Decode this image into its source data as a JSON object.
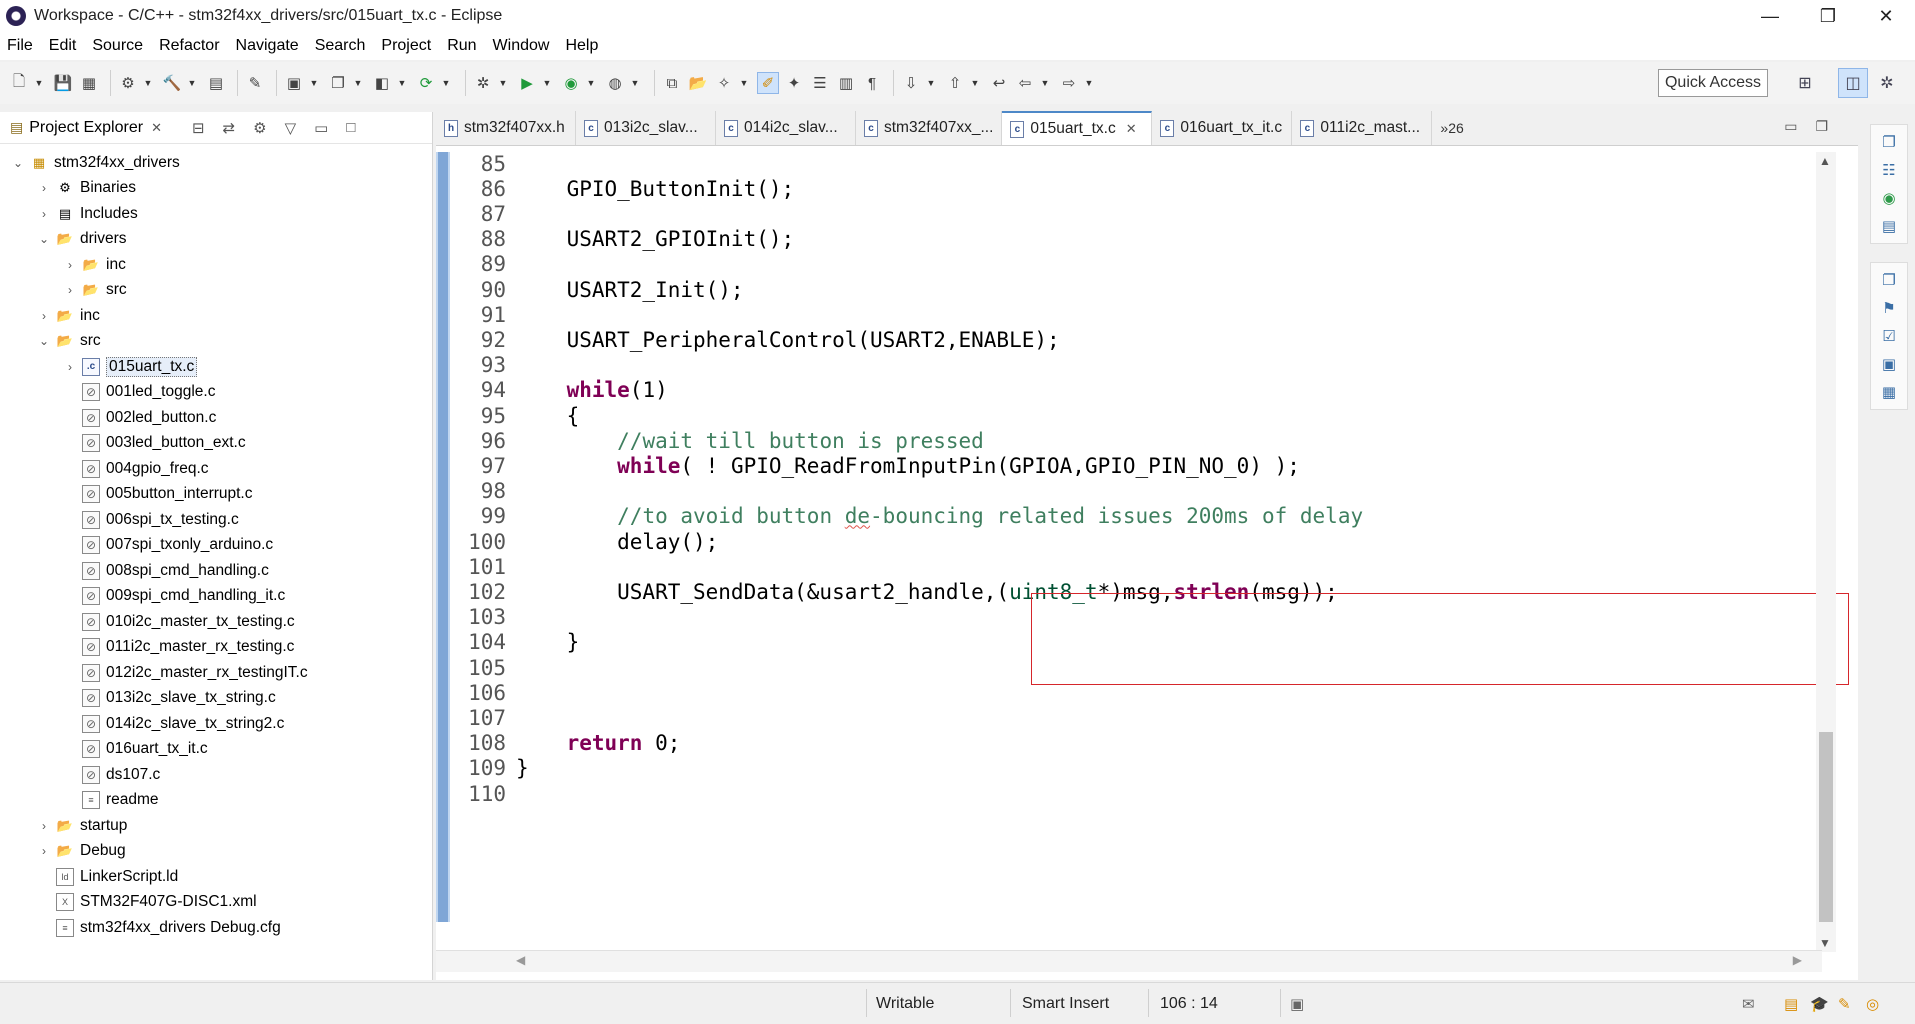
{
  "window": {
    "title": "Workspace - C/C++ - stm32f4xx_drivers/src/015uart_tx.c - Eclipse",
    "minimize": "—",
    "maximize": "❐",
    "close": "✕"
  },
  "menu": [
    "File",
    "Edit",
    "Source",
    "Refactor",
    "Navigate",
    "Search",
    "Project",
    "Run",
    "Window",
    "Help"
  ],
  "toolbar": {
    "quick_access": "Quick Access"
  },
  "explorer": {
    "title": "Project Explorer",
    "close": "✕",
    "tree": [
      {
        "label": "stm32f4xx_drivers",
        "depth": 0,
        "arrow": "v",
        "icon": "project"
      },
      {
        "label": "Binaries",
        "depth": 1,
        "arrow": ">",
        "icon": "binaries"
      },
      {
        "label": "Includes",
        "depth": 1,
        "arrow": ">",
        "icon": "includes"
      },
      {
        "label": "drivers",
        "depth": 1,
        "arrow": "v",
        "icon": "folder"
      },
      {
        "label": "inc",
        "depth": 2,
        "arrow": ">",
        "icon": "folder"
      },
      {
        "label": "src",
        "depth": 2,
        "arrow": ">",
        "icon": "folder"
      },
      {
        "label": "inc",
        "depth": 1,
        "arrow": ">",
        "icon": "folder"
      },
      {
        "label": "src",
        "depth": 1,
        "arrow": "v",
        "icon": "folder"
      },
      {
        "label": "015uart_tx.c",
        "depth": 2,
        "arrow": ">",
        "icon": "c-file",
        "selected": true
      },
      {
        "label": "001led_toggle.c",
        "depth": 2,
        "arrow": "",
        "icon": "excluded-file"
      },
      {
        "label": "002led_button.c",
        "depth": 2,
        "arrow": "",
        "icon": "excluded-file"
      },
      {
        "label": "003led_button_ext.c",
        "depth": 2,
        "arrow": "",
        "icon": "excluded-file"
      },
      {
        "label": "004gpio_freq.c",
        "depth": 2,
        "arrow": "",
        "icon": "excluded-file"
      },
      {
        "label": "005button_interrupt.c",
        "depth": 2,
        "arrow": "",
        "icon": "excluded-file"
      },
      {
        "label": "006spi_tx_testing.c",
        "depth": 2,
        "arrow": "",
        "icon": "excluded-file"
      },
      {
        "label": "007spi_txonly_arduino.c",
        "depth": 2,
        "arrow": "",
        "icon": "excluded-file"
      },
      {
        "label": "008spi_cmd_handling.c",
        "depth": 2,
        "arrow": "",
        "icon": "excluded-file"
      },
      {
        "label": "009spi_cmd_handling_it.c",
        "depth": 2,
        "arrow": "",
        "icon": "excluded-file"
      },
      {
        "label": "010i2c_master_tx_testing.c",
        "depth": 2,
        "arrow": "",
        "icon": "excluded-file"
      },
      {
        "label": "011i2c_master_rx_testing.c",
        "depth": 2,
        "arrow": "",
        "icon": "excluded-file"
      },
      {
        "label": "012i2c_master_rx_testingIT.c",
        "depth": 2,
        "arrow": "",
        "icon": "excluded-file"
      },
      {
        "label": "013i2c_slave_tx_string.c",
        "depth": 2,
        "arrow": "",
        "icon": "excluded-file"
      },
      {
        "label": "014i2c_slave_tx_string2.c",
        "depth": 2,
        "arrow": "",
        "icon": "excluded-file"
      },
      {
        "label": "016uart_tx_it.c",
        "depth": 2,
        "arrow": "",
        "icon": "excluded-file"
      },
      {
        "label": "ds107.c",
        "depth": 2,
        "arrow": "",
        "icon": "excluded-file"
      },
      {
        "label": "readme",
        "depth": 2,
        "arrow": "",
        "icon": "text-file"
      },
      {
        "label": "startup",
        "depth": 1,
        "arrow": ">",
        "icon": "folder"
      },
      {
        "label": "Debug",
        "depth": 1,
        "arrow": ">",
        "icon": "folder"
      },
      {
        "label": "LinkerScript.ld",
        "depth": 1,
        "arrow": "",
        "icon": "ld-file"
      },
      {
        "label": "STM32F407G-DISC1.xml",
        "depth": 1,
        "arrow": "",
        "icon": "xml-file"
      },
      {
        "label": "stm32f4xx_drivers Debug.cfg",
        "depth": 1,
        "arrow": "",
        "icon": "cfg-file"
      }
    ]
  },
  "editor": {
    "tabs": [
      {
        "label": "stm32f407xx.h",
        "icon": "h"
      },
      {
        "label": "013i2c_slav...",
        "icon": "c"
      },
      {
        "label": "014i2c_slav...",
        "icon": "c"
      },
      {
        "label": "stm32f407xx_...",
        "icon": "c"
      },
      {
        "label": "015uart_tx.c",
        "icon": "c",
        "active": true
      },
      {
        "label": "016uart_tx_it.c",
        "icon": "c"
      },
      {
        "label": "011i2c_mast...",
        "icon": "c"
      }
    ],
    "tab_close": "✕",
    "overflow": "»26",
    "lines": [
      {
        "n": "85",
        "code": ""
      },
      {
        "n": "86",
        "code": "    GPIO_ButtonInit();"
      },
      {
        "n": "87",
        "code": ""
      },
      {
        "n": "88",
        "code": "    USART2_GPIOInit();"
      },
      {
        "n": "89",
        "code": ""
      },
      {
        "n": "90",
        "code": "    USART2_Init();"
      },
      {
        "n": "91",
        "code": ""
      },
      {
        "n": "92",
        "code": "    USART_PeripheralControl(USART2,ENABLE);"
      },
      {
        "n": "93",
        "code": ""
      },
      {
        "n": "94",
        "code": "    while(1)"
      },
      {
        "n": "95",
        "code": "    {"
      },
      {
        "n": "96",
        "code": "        //wait till button is pressed"
      },
      {
        "n": "97",
        "code": "        while( ! GPIO_ReadFromInputPin(GPIOA,GPIO_PIN_NO_0) );"
      },
      {
        "n": "98",
        "code": ""
      },
      {
        "n": "99",
        "code": "        //to avoid button de-bouncing related issues 200ms of delay"
      },
      {
        "n": "100",
        "code": "        delay();"
      },
      {
        "n": "101",
        "code": ""
      },
      {
        "n": "102",
        "code": "        USART_SendData(&usart2_handle,(uint8_t*)msg,strlen(msg));"
      },
      {
        "n": "103",
        "code": ""
      },
      {
        "n": "104",
        "code": "    }"
      },
      {
        "n": "105",
        "code": ""
      },
      {
        "n": "106",
        "code": ""
      },
      {
        "n": "107",
        "code": ""
      },
      {
        "n": "108",
        "code": "    return 0;"
      },
      {
        "n": "109",
        "code": "}"
      },
      {
        "n": "110",
        "code": ""
      }
    ]
  },
  "status": {
    "writable": "Writable",
    "insert_mode": "Smart Insert",
    "position": "106 : 14"
  },
  "colors": {
    "keyword": "#7f0055",
    "comment": "#3f7f5f",
    "highlight_box": "#d6262b",
    "active_tab_accent": "#4d88c8"
  }
}
